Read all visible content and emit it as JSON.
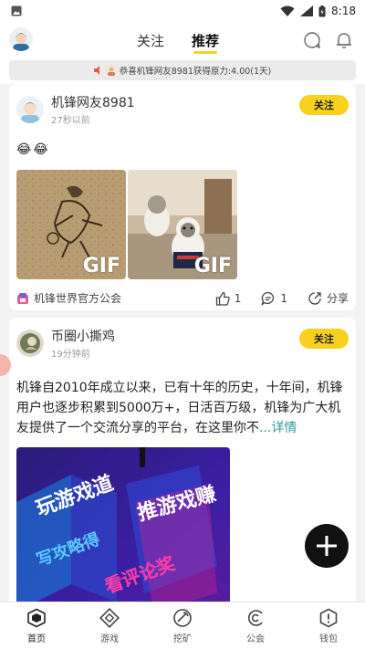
{
  "status_bar": {
    "time": "8:18"
  },
  "header": {
    "tabs": [
      {
        "label": "关注",
        "active": false
      },
      {
        "label": "推荐",
        "active": true
      }
    ]
  },
  "notice": {
    "text": "恭喜机锋网友8981获得原力:4.00(1天)"
  },
  "posts": [
    {
      "username": "机锋网友8981",
      "time": "27秒以前",
      "follow_label": "关注",
      "emoji": [
        "😂",
        "😂"
      ],
      "images": [
        {
          "label": "GIF",
          "icon": "ink-painting-gif"
        },
        {
          "label": "GIF",
          "icon": "cats-gif"
        }
      ],
      "guild": "机锋世界官方公会",
      "likes": "1",
      "comments": "1",
      "share_label": "分享"
    },
    {
      "username": "币圈小撕鸡",
      "time": "19分钟前",
      "follow_label": "关注",
      "text": "机锋自2010年成立以来，已有十年的历史，十年间，机锋用户也逐步积累到5000万+，日活百万级，机锋为广大机友提供了一个交流分享的平台，在这里你不",
      "more": "...详情",
      "banner_texts": [
        "玩游戏道",
        "推游戏赚",
        "写攻略得",
        "看评论奖"
      ]
    }
  ],
  "bottom_nav": [
    {
      "label": "首页",
      "icon": "home-cube-icon",
      "active": true
    },
    {
      "label": "游戏",
      "icon": "game-diamond-icon",
      "active": false
    },
    {
      "label": "挖矿",
      "icon": "mining-icon",
      "active": false
    },
    {
      "label": "公会",
      "icon": "guild-icon",
      "active": false
    },
    {
      "label": "钱包",
      "icon": "wallet-icon",
      "active": false
    }
  ],
  "colors": {
    "accent": "#f7d11e",
    "link": "#2a9d9c"
  }
}
